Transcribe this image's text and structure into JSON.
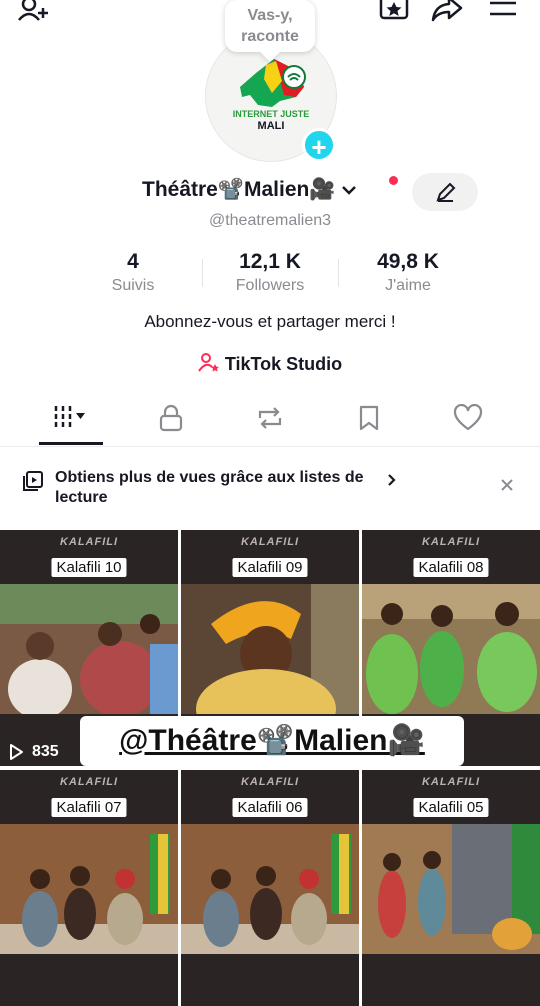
{
  "profile": {
    "bubble_text": "Vas-y, raconte",
    "logo_text_line1": "INTERNET JUSTE",
    "logo_text_line2": "MALI",
    "display_name": "Théâtre📽️Malien🎥",
    "handle": "@theatremalien3",
    "bio": "Abonnez-vous et partager merci !",
    "studio_label": "TikTok Studio"
  },
  "stats": [
    {
      "value": "4",
      "label": "Suivis"
    },
    {
      "value": "12,1 K",
      "label": "Followers"
    },
    {
      "value": "49,8 K",
      "label": "J'aime"
    }
  ],
  "banner": {
    "text": "Obtiens plus de vues grâce aux listes de lecture"
  },
  "videos": [
    {
      "brand": "KALAFILI",
      "title": "Kalafili 10",
      "views": "835"
    },
    {
      "brand": "KALAFILI",
      "title": "Kalafili 09"
    },
    {
      "brand": "KALAFILI",
      "title": "Kalafili 08"
    },
    {
      "brand": "KALAFILI",
      "title": "Kalafili 07"
    },
    {
      "brand": "KALAFILI",
      "title": "Kalafili 06"
    },
    {
      "brand": "KALAFILI",
      "title": "Kalafili 05"
    }
  ],
  "overlay_text": "@Théâtre📽️Malien🎥",
  "colors": {
    "accent": "#fe2c55",
    "plus": "#20d5ec",
    "text": "#161823",
    "muted": "#8a8b91"
  }
}
